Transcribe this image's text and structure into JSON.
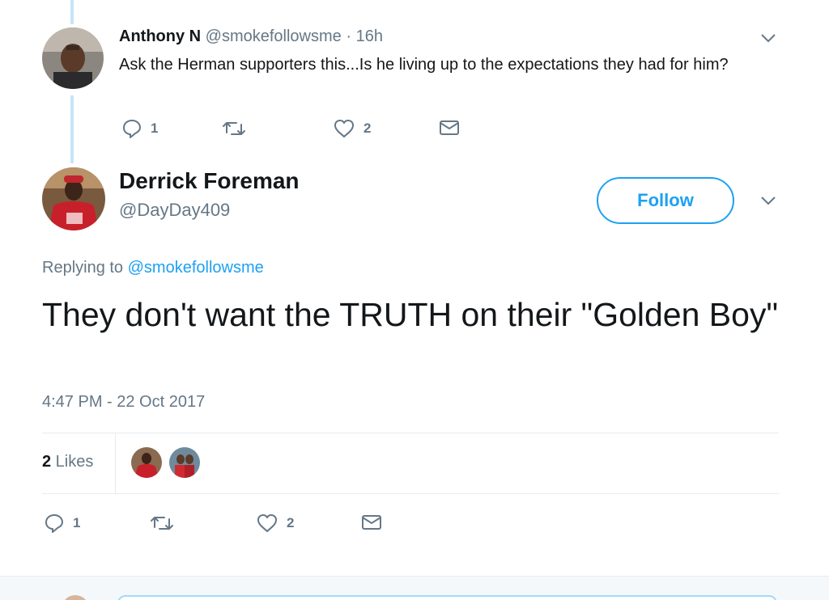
{
  "parent_tweet": {
    "name": "Anthony N",
    "handle": "@smokefollowsme",
    "dot": "·",
    "time": "16h",
    "text": "Ask the Herman supporters this...Is he living up to the expectations they had for him?",
    "reply_count": "1",
    "like_count": "2"
  },
  "main_tweet": {
    "name": "Derrick Foreman",
    "handle": "@DayDay409",
    "follow_label": "Follow",
    "replying_prefix": "Replying to ",
    "replying_to": "@smokefollowsme",
    "text": "They don't want the TRUTH on their \"Golden Boy\"",
    "timestamp": "4:47 PM - 22 Oct 2017",
    "likes_count": "2",
    "likes_label": " Likes",
    "reply_count": "1",
    "like_count": "2"
  },
  "colors": {
    "accent": "#1da1f2",
    "secondary_text": "#657786",
    "thread_line": "#c4e5f9"
  }
}
